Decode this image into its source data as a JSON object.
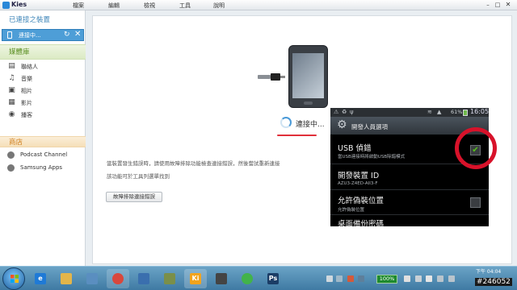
{
  "app": {
    "name": "Kies"
  },
  "menu": [
    "檔案",
    "編輯",
    "檢視",
    "工具",
    "說明"
  ],
  "sidebar": {
    "connected_header": "已連接之裝置",
    "device_label": "連接中...",
    "library_header": "媒體庫",
    "library_items": [
      {
        "label": "聯絡人",
        "icon": "contacts-icon"
      },
      {
        "label": "音樂",
        "icon": "music-icon"
      },
      {
        "label": "相片",
        "icon": "photos-icon"
      },
      {
        "label": "影片",
        "icon": "videos-icon"
      },
      {
        "label": "播客",
        "icon": "podcast-icon"
      }
    ],
    "store_header": "商店",
    "store_items": [
      {
        "label": "Podcast Channel",
        "icon": "podcast-channel-icon"
      },
      {
        "label": "Samsung Apps",
        "icon": "samsung-apps-icon"
      }
    ]
  },
  "main": {
    "connecting_text": "連接中...",
    "error_line_1": "當裝置發生錯誤時，請使用故障排除功能檢查連接錯誤，然後嘗試重新連接",
    "error_line_2": "該功能可於工具列選單找到",
    "troubleshoot_button": "故障排除連接錯誤"
  },
  "android": {
    "battery_pct": "61%",
    "time": "16:05",
    "header_title": "開發人員選項",
    "rows": [
      {
        "title": "USB 偵錯",
        "sub": "當USB連接時將啟動USB除錯模式",
        "checked": true
      },
      {
        "title": "開發裝置 ID",
        "sub": "AZU3-Z4ED-AII3-F",
        "checked": null
      },
      {
        "title": "允許偽裝位置",
        "sub": "允許偽裝位置",
        "checked": false
      },
      {
        "title": "桌面備份密碼",
        "sub": "",
        "checked": null
      }
    ]
  },
  "taskbar": {
    "zoom": "100%",
    "time": "下午 04:04",
    "watermark": "#246052"
  },
  "colors": {
    "accent_blue": "#4e9ed7",
    "library_green": "#5b8f23",
    "store_orange": "#cf7d1a",
    "highlight_red": "#d8122a"
  }
}
